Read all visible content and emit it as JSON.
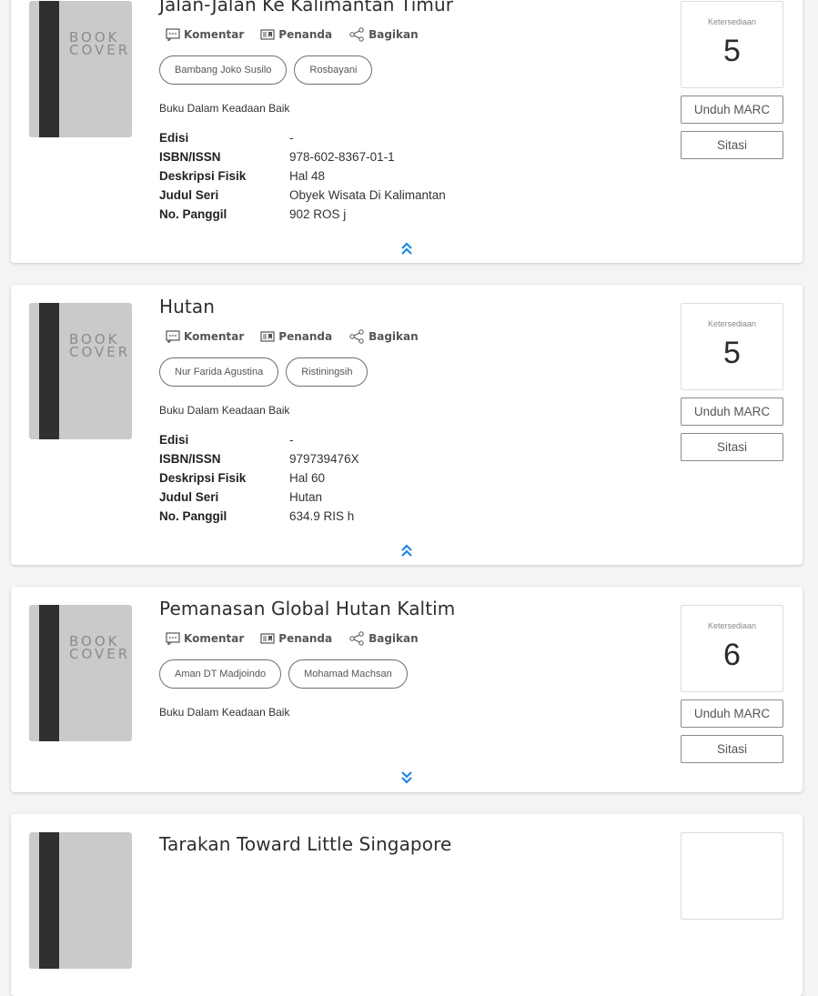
{
  "common": {
    "cover_text_line1": "BOOK",
    "cover_text_line2": "COVER",
    "comment_label": "Komentar",
    "bookmark_label": "Penanda",
    "share_label": "Bagikan",
    "availability_label": "Ketersediaan",
    "marc_label": "Unduh MARC",
    "cite_label": "Sitasi",
    "label_edition": "Edisi",
    "label_isbn": "ISBN/ISSN",
    "label_physical": "Deskripsi Fisik",
    "label_series": "Judul Seri",
    "label_callno": "No. Panggil",
    "accent_color": "#1e88e5"
  },
  "books": [
    {
      "title": "Jalan-Jalan Ke Kalimantan Timur",
      "authors": [
        "Bambang Joko Susilo",
        "Rosbayani"
      ],
      "condition": "Buku Dalam Keadaan Baik",
      "edition": "-",
      "isbn": "978-602-8367-01-1",
      "physical": "Hal 48",
      "series": "Obyek Wisata Di Kalimantan",
      "callno": "902 ROS j",
      "availability": "5",
      "expanded": true
    },
    {
      "title": "Hutan",
      "authors": [
        "Nur Farida Agustina",
        "Ristiningsih"
      ],
      "condition": "Buku Dalam Keadaan Baik",
      "edition": "-",
      "isbn": "979739476X",
      "physical": "Hal 60",
      "series": "Hutan",
      "callno": "634.9 RIS h",
      "availability": "5",
      "expanded": true
    },
    {
      "title": "Pemanasan Global Hutan Kaltim",
      "authors": [
        "Aman DT Madjoindo",
        "Mohamad Machsan"
      ],
      "condition": "Buku Dalam Keadaan Baik",
      "availability": "6",
      "expanded": false
    },
    {
      "title": "Tarakan Toward Little Singapore"
    }
  ]
}
